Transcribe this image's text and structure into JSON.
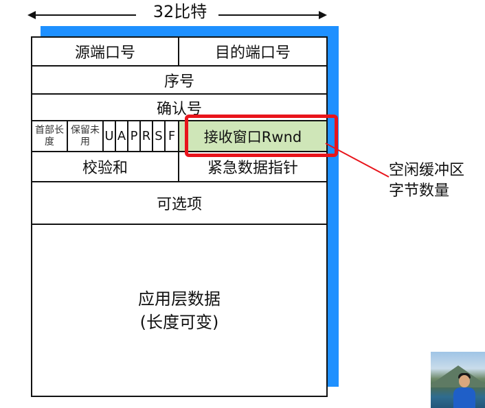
{
  "width_label": "32比特",
  "fields": {
    "source_port": "源端口号",
    "dest_port": "目的端口号",
    "sequence_number": "序号",
    "ack_number": "确认号",
    "header_length": "首部长度",
    "reserved": "保留未用",
    "flags": [
      "U",
      "A",
      "P",
      "R",
      "S",
      "F"
    ],
    "receive_window": "接收窗口Rwnd",
    "checksum": "校验和",
    "urgent_pointer": "紧急数据指针",
    "options": "可选项",
    "app_data_line1": "应用层数据",
    "app_data_line2": "(长度可变)"
  },
  "annotation": {
    "line1": "空闲缓冲区",
    "line2": "字节数量"
  },
  "colors": {
    "frame_shadow": "#1E90FF",
    "highlight_box": "#E8141B",
    "window_field_fill": "#CFE6B8"
  }
}
